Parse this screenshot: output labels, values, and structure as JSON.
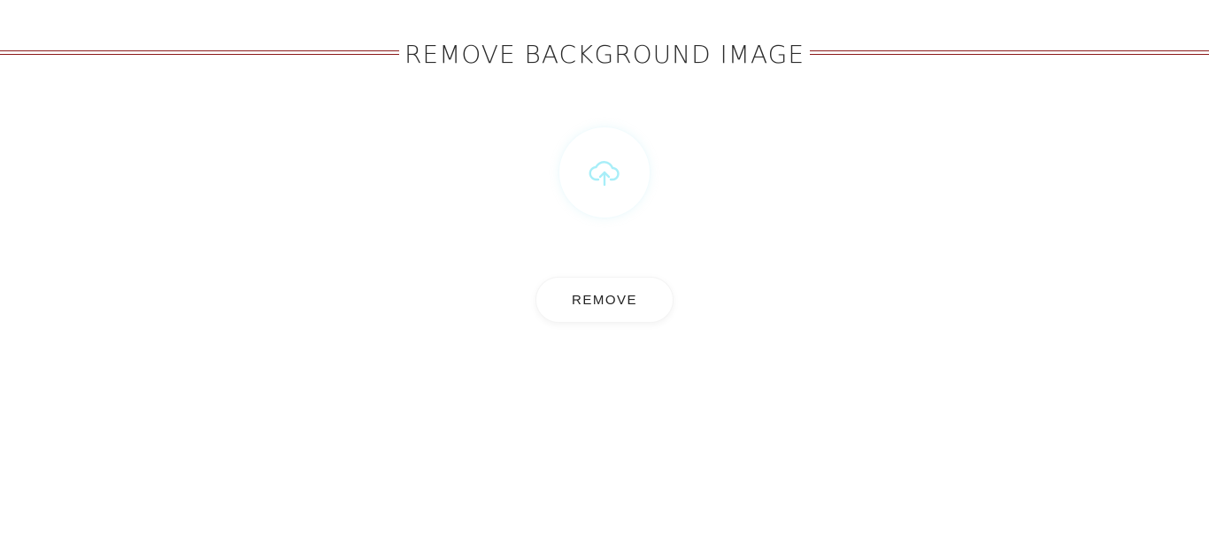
{
  "header": {
    "title": "REMOVE BACKGROUND IMAGE",
    "rule_color": "#8b1a1a"
  },
  "upload": {
    "icon": "cloud-upload-icon",
    "icon_color": "#a8eef8"
  },
  "actions": {
    "remove_label": "REMOVE"
  }
}
